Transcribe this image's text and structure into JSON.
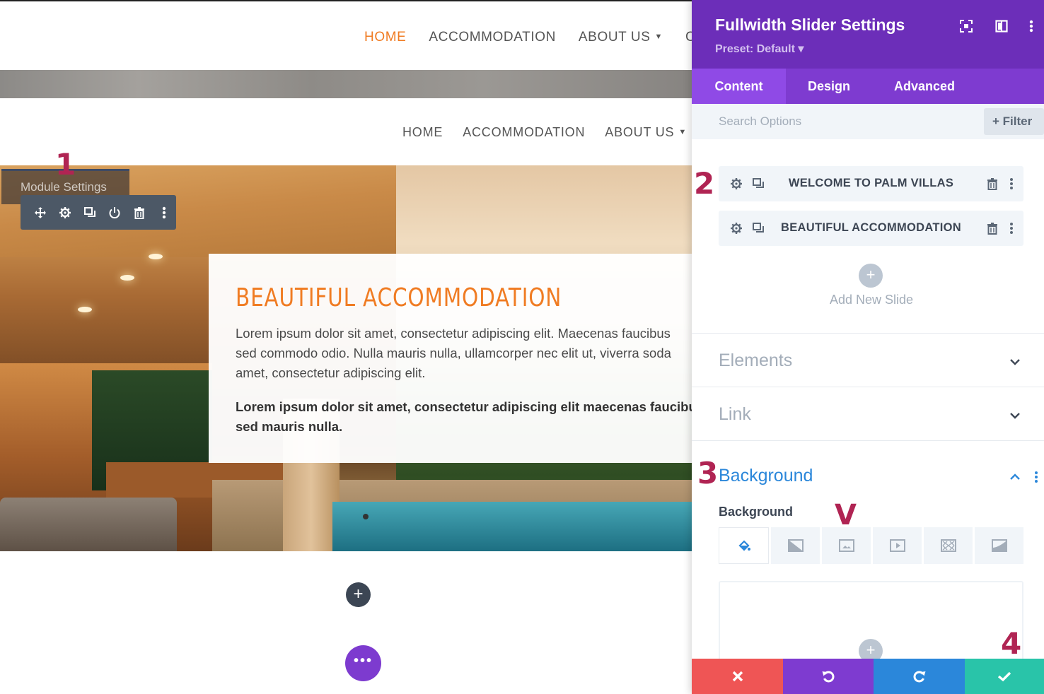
{
  "page": {
    "nav_primary": [
      "HOME",
      "ACCOMMODATION",
      "ABOUT US",
      "C"
    ],
    "nav_secondary": [
      "HOME",
      "ACCOMMODATION",
      "ABOUT US"
    ],
    "slide": {
      "title": "BEAUTIFUL ACCOMMODATION",
      "para1_line1": "Lorem ipsum dolor sit amet, consectetur adipiscing elit. Maecenas faucibus",
      "para1_line2": "sed commodo odio. Nulla mauris nulla, ullamcorper nec elit ut, viverra soda",
      "para1_line3": "amet, consectetur adipiscing elit.",
      "para2_line1": "Lorem ipsum dolor sit amet, consectetur adipiscing elit maecenas faucibu",
      "para2_line2": "sed mauris nulla."
    },
    "module_settings_label": "Module Settings",
    "add_module_symbol": "+",
    "more_symbol": "•••"
  },
  "annotations": [
    "1",
    "2",
    "3",
    "4",
    "V"
  ],
  "panel": {
    "title": "Fullwidth Slider Settings",
    "preset": "Preset: Default ▾",
    "tabs": [
      "Content",
      "Design",
      "Advanced"
    ],
    "active_tab": "Content",
    "search_placeholder": "Search Options",
    "filter_label": "+ Filter",
    "slides": [
      "WELCOME TO PALM VILLAS",
      "BEAUTIFUL ACCOMMODATION"
    ],
    "add_slide_symbol": "+",
    "add_slide_label": "Add New Slide",
    "sections": [
      "Elements",
      "Link",
      "Background"
    ],
    "background_field_label": "Background",
    "background_types": [
      "color-icon",
      "gradient-icon",
      "image-icon",
      "video-icon",
      "pattern-icon",
      "mask-icon"
    ]
  },
  "footer": {
    "buttons": [
      "close-icon",
      "undo-icon",
      "redo-icon",
      "save-check-icon"
    ]
  },
  "colors": {
    "accent_orange": "#f07c23",
    "panel_header": "#6c2eb9",
    "panel_tabs": "#7e3bd0",
    "annotation": "#b02453",
    "discard": "#ef5555",
    "undo": "#7e3bd0",
    "redo": "#2b87da",
    "save": "#29c4a9"
  }
}
